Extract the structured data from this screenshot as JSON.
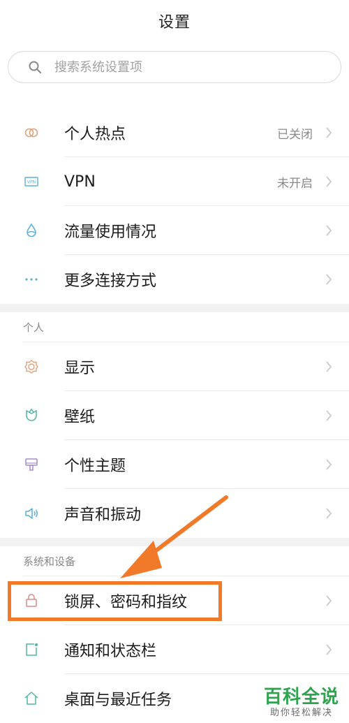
{
  "header": {
    "title": "设置"
  },
  "search": {
    "placeholder": "搜索系统设置项"
  },
  "network": {
    "items": [
      {
        "label": "个人热点",
        "value": "已关闭",
        "icon": "hotspot-icon",
        "color": "#e0a27a"
      },
      {
        "label": "VPN",
        "value": "未开启",
        "icon": "vpn-icon",
        "color": "#5ab0d6"
      },
      {
        "label": "流量使用情况",
        "value": "",
        "icon": "data-usage-icon",
        "color": "#5ab0d6"
      },
      {
        "label": "更多连接方式",
        "value": "",
        "icon": "more-dots-icon",
        "color": "#5ab0d6"
      }
    ]
  },
  "personal": {
    "header": "个人",
    "items": [
      {
        "label": "显示",
        "icon": "display-sun-icon",
        "color": "#e0a27a"
      },
      {
        "label": "壁纸",
        "icon": "wallpaper-tulip-icon",
        "color": "#4fb7a6"
      },
      {
        "label": "个性主题",
        "icon": "theme-brush-icon",
        "color": "#a78bd0"
      },
      {
        "label": "声音和振动",
        "icon": "sound-speaker-icon",
        "color": "#5ab0d6"
      }
    ]
  },
  "system": {
    "header": "系统和设备",
    "items": [
      {
        "label": "锁屏、密码和指纹",
        "icon": "lock-icon",
        "color": "#d98a8a"
      },
      {
        "label": "通知和状态栏",
        "icon": "notification-icon",
        "color": "#4fb7a6"
      },
      {
        "label": "桌面与最近任务",
        "icon": "home-icon",
        "color": "#4fb7a6"
      }
    ]
  },
  "annotation": {
    "color": "#f07a2a"
  },
  "watermark": {
    "main": "百科全说",
    "sub": "助你轻松解决"
  }
}
